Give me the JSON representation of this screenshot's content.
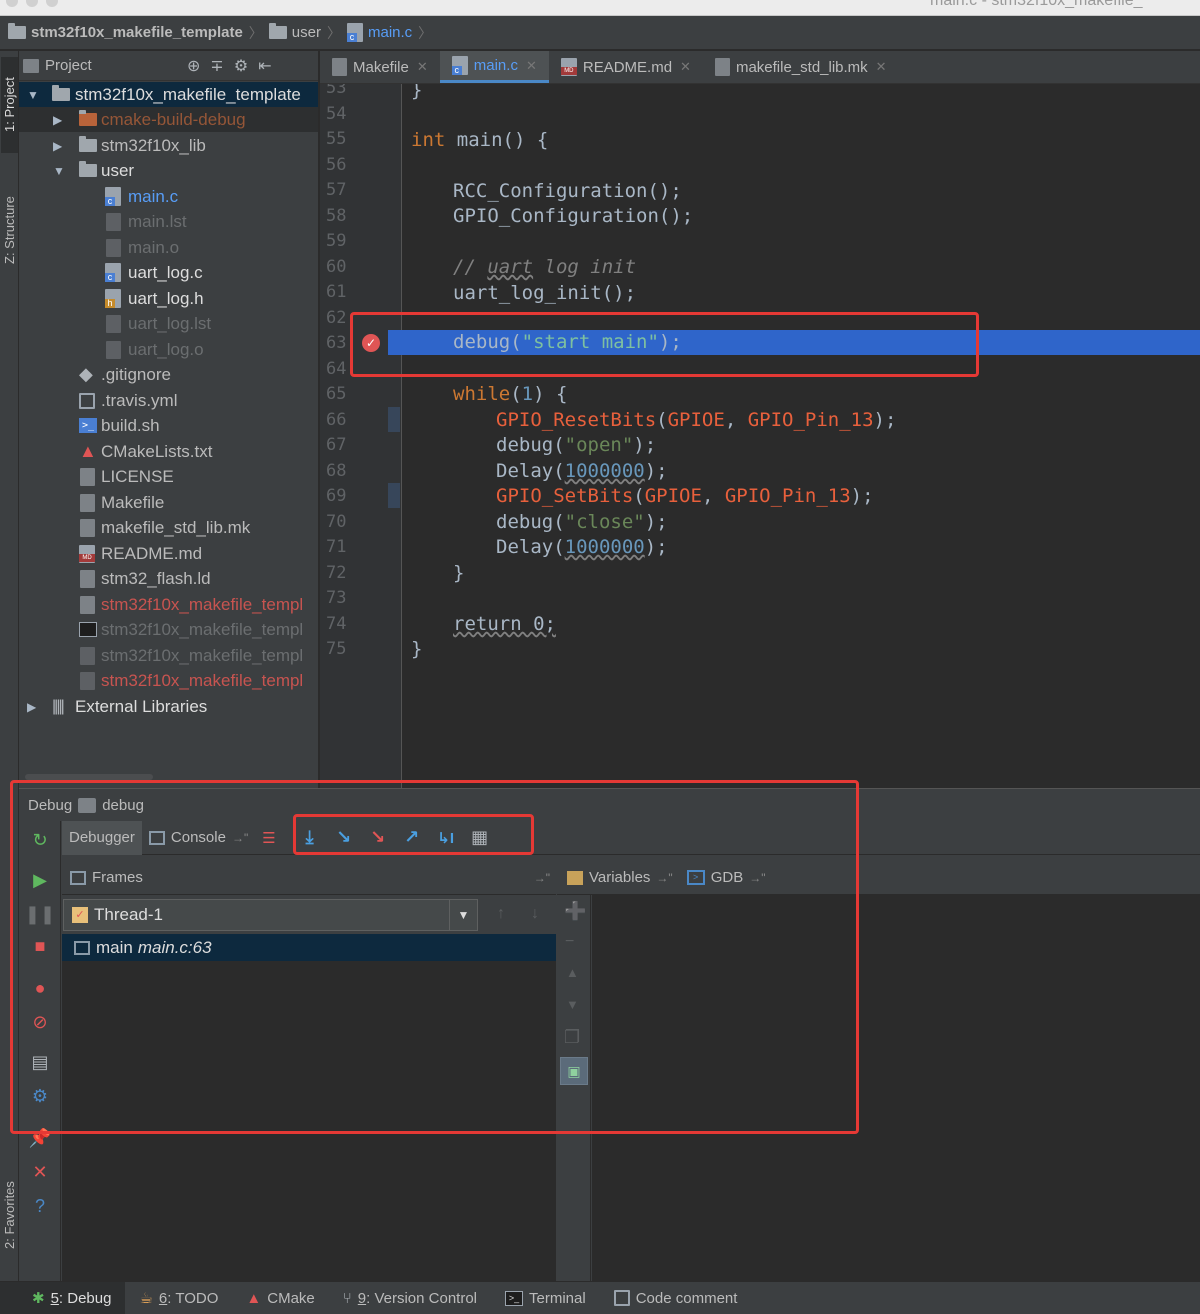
{
  "window_title": "main.c - stm32f10x_makefile_",
  "breadcrumb": {
    "project": "stm32f10x_makefile_template",
    "folder": "user",
    "file": "main.c"
  },
  "sidebar_tabs": {
    "project": "1: Project",
    "structure": "Z: Structure",
    "favorites": "2: Favorites"
  },
  "project_panel": {
    "title": "Project",
    "root": "stm32f10x_makefile_template",
    "items": [
      {
        "label": "cmake-build-debug"
      },
      {
        "label": "stm32f10x_lib"
      },
      {
        "label": "user"
      },
      {
        "label": "main.c"
      },
      {
        "label": "main.lst"
      },
      {
        "label": "main.o"
      },
      {
        "label": "uart_log.c"
      },
      {
        "label": "uart_log.h"
      },
      {
        "label": "uart_log.lst"
      },
      {
        "label": "uart_log.o"
      },
      {
        "label": ".gitignore"
      },
      {
        "label": ".travis.yml"
      },
      {
        "label": "build.sh"
      },
      {
        "label": "CMakeLists.txt"
      },
      {
        "label": "LICENSE"
      },
      {
        "label": "Makefile"
      },
      {
        "label": "makefile_std_lib.mk"
      },
      {
        "label": "README.md"
      },
      {
        "label": "stm32_flash.ld"
      },
      {
        "label": "stm32f10x_makefile_templ"
      },
      {
        "label": "stm32f10x_makefile_templ"
      },
      {
        "label": "stm32f10x_makefile_templ"
      },
      {
        "label": "stm32f10x_makefile_templ"
      }
    ],
    "external": "External Libraries"
  },
  "editor_tabs": [
    {
      "label": "Makefile"
    },
    {
      "label": "main.c"
    },
    {
      "label": "README.md"
    },
    {
      "label": "makefile_std_lib.mk"
    }
  ],
  "line_numbers": [
    "53",
    "54",
    "55",
    "56",
    "57",
    "58",
    "59",
    "60",
    "61",
    "62",
    "63",
    "64",
    "65",
    "66",
    "67",
    "68",
    "69",
    "70",
    "71",
    "72",
    "73",
    "74",
    "75"
  ],
  "code": {
    "l53": "}",
    "l55_kw": "int",
    "l55_rest": " main() {",
    "l57": "RCC_Configuration();",
    "l58": "GPIO_Configuration();",
    "l60_a": "// ",
    "l60_b": "uart",
    "l60_c": " log init",
    "l61": "uart_log_init();",
    "l63_a": "debug(",
    "l63_b": "\"start main\"",
    "l63_c": ");",
    "l65_a": "while",
    "l65_b": "(",
    "l65_c": "1",
    "l65_d": ") {",
    "l66_a": "GPIO_ResetBits",
    "l66_b": "(",
    "l66_c": "GPIOE",
    "l66_d": ", ",
    "l66_e": "GPIO_Pin_13",
    "l66_f": ");",
    "l67_a": "debug(",
    "l67_b": "\"open\"",
    "l67_c": ");",
    "l68_a": "Delay(",
    "l68_b": "1000000",
    "l68_c": ");",
    "l69_a": "GPIO_SetBits",
    "l69_b": "(",
    "l69_c": "GPIOE",
    "l69_d": ", ",
    "l69_e": "GPIO_Pin_13",
    "l69_f": ");",
    "l70_a": "debug(",
    "l70_b": "\"close\"",
    "l70_c": ");",
    "l71_a": "Delay(",
    "l71_b": "1000000",
    "l71_c": ");",
    "l72": "}",
    "l74": "return 0;",
    "l75": "}"
  },
  "debug": {
    "label": "Debug",
    "config": "debug",
    "tabs": {
      "debugger": "Debugger",
      "console": "Console"
    },
    "frames_title": "Frames",
    "variables_title": "Variables",
    "gdb_title": "GDB",
    "pin_suffix": "→\"",
    "thread": "Thread-1",
    "frame_func": "main",
    "frame_loc": "main.c:63"
  },
  "statusbar": [
    {
      "num": "5",
      "label": ": Debug"
    },
    {
      "num": "6",
      "label": ": TODO"
    },
    {
      "num": "",
      "label": "CMake"
    },
    {
      "num": "9",
      "label": ": Version Control"
    },
    {
      "num": "",
      "label": "Terminal"
    },
    {
      "num": "",
      "label": "Code comment"
    }
  ],
  "colors": {
    "highlight": "#2f65ca",
    "annotation_box": "#e53935",
    "keyword": "#cc7832",
    "string": "#6a8759",
    "number": "#6897bb",
    "macro": "#e8603c"
  }
}
